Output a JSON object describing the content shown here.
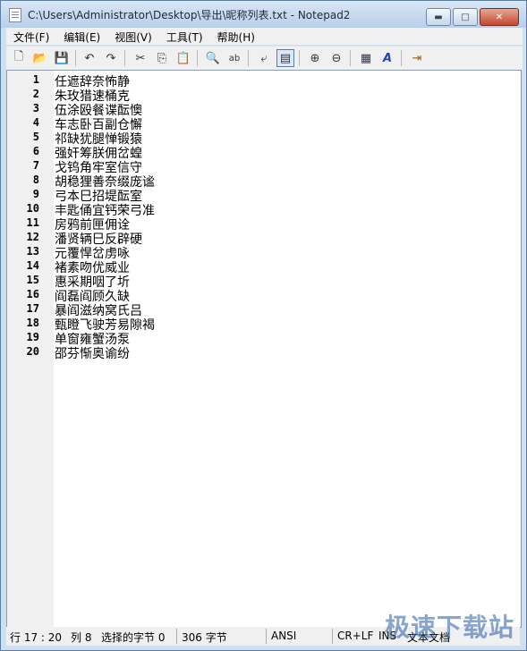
{
  "window": {
    "title": "C:\\Users\\Administrator\\Desktop\\导出\\昵称列表.txt - Notepad2",
    "minimize_glyph": "▬",
    "maximize_glyph": "□",
    "close_glyph": "✕"
  },
  "menu": [
    "文件(F)",
    "编辑(E)",
    "视图(V)",
    "工具(T)",
    "帮助(H)"
  ],
  "toolbar": {
    "new": "🗋",
    "open": "📂",
    "save": "💾",
    "undo": "↶",
    "redo": "↷",
    "cut": "✂",
    "copy": "⎘",
    "paste": "📋",
    "find": "🔍",
    "replace": "ab",
    "wordwrap": "⤶",
    "wrap_toggle": "▤",
    "zoom_in": "⊕",
    "zoom_out": "⊖",
    "scheme": "▦",
    "font": "A",
    "exit": "⇥"
  },
  "editor": {
    "lines": [
      {
        "n": "1",
        "text": "任遮辞奈怖静"
      },
      {
        "n": "2",
        "text": "朱玫猎速桶克"
      },
      {
        "n": "3",
        "text": "伍涂殴餐谍酝懊"
      },
      {
        "n": "4",
        "text": "车志卧百副仓懈"
      },
      {
        "n": "5",
        "text": "祁缺犹腿惮锻猿"
      },
      {
        "n": "6",
        "text": "强奸筹朕佣岔蝗"
      },
      {
        "n": "7",
        "text": "戈钨角牢室信守"
      },
      {
        "n": "8",
        "text": "胡稳狸善奈缀庞谧"
      },
      {
        "n": "9",
        "text": "弓本巳招堤酝室"
      },
      {
        "n": "10",
        "text": "丰匙俑宜钙荣弓准"
      },
      {
        "n": "11",
        "text": "房鸦前匣佣诠"
      },
      {
        "n": "12",
        "text": "潘贤辆巳反辟硬"
      },
      {
        "n": "13",
        "text": "元覆悍岔虏咏"
      },
      {
        "n": "14",
        "text": "褚素吻优威业"
      },
      {
        "n": "15",
        "text": "惠采期咽了圻"
      },
      {
        "n": "16",
        "text": "阎磊阎顾久缺"
      },
      {
        "n": "17",
        "text": "暴阎滋纳窝氏吕"
      },
      {
        "n": "18",
        "text": "甄瞪飞驶芳易隙褐"
      },
      {
        "n": "19",
        "text": "单窗雍蟹汤泵"
      },
      {
        "n": "20",
        "text": "邵芬惭奥谕纷"
      }
    ]
  },
  "status": {
    "position": "行 17 : 20",
    "column": "列 8",
    "selection": "选择的字节 0",
    "size": "306 字节",
    "encoding": "ANSI",
    "line_ending": "CR+LF",
    "insert_mode": "INS",
    "doc_type": "文本文档"
  },
  "watermark": "极速下载站"
}
